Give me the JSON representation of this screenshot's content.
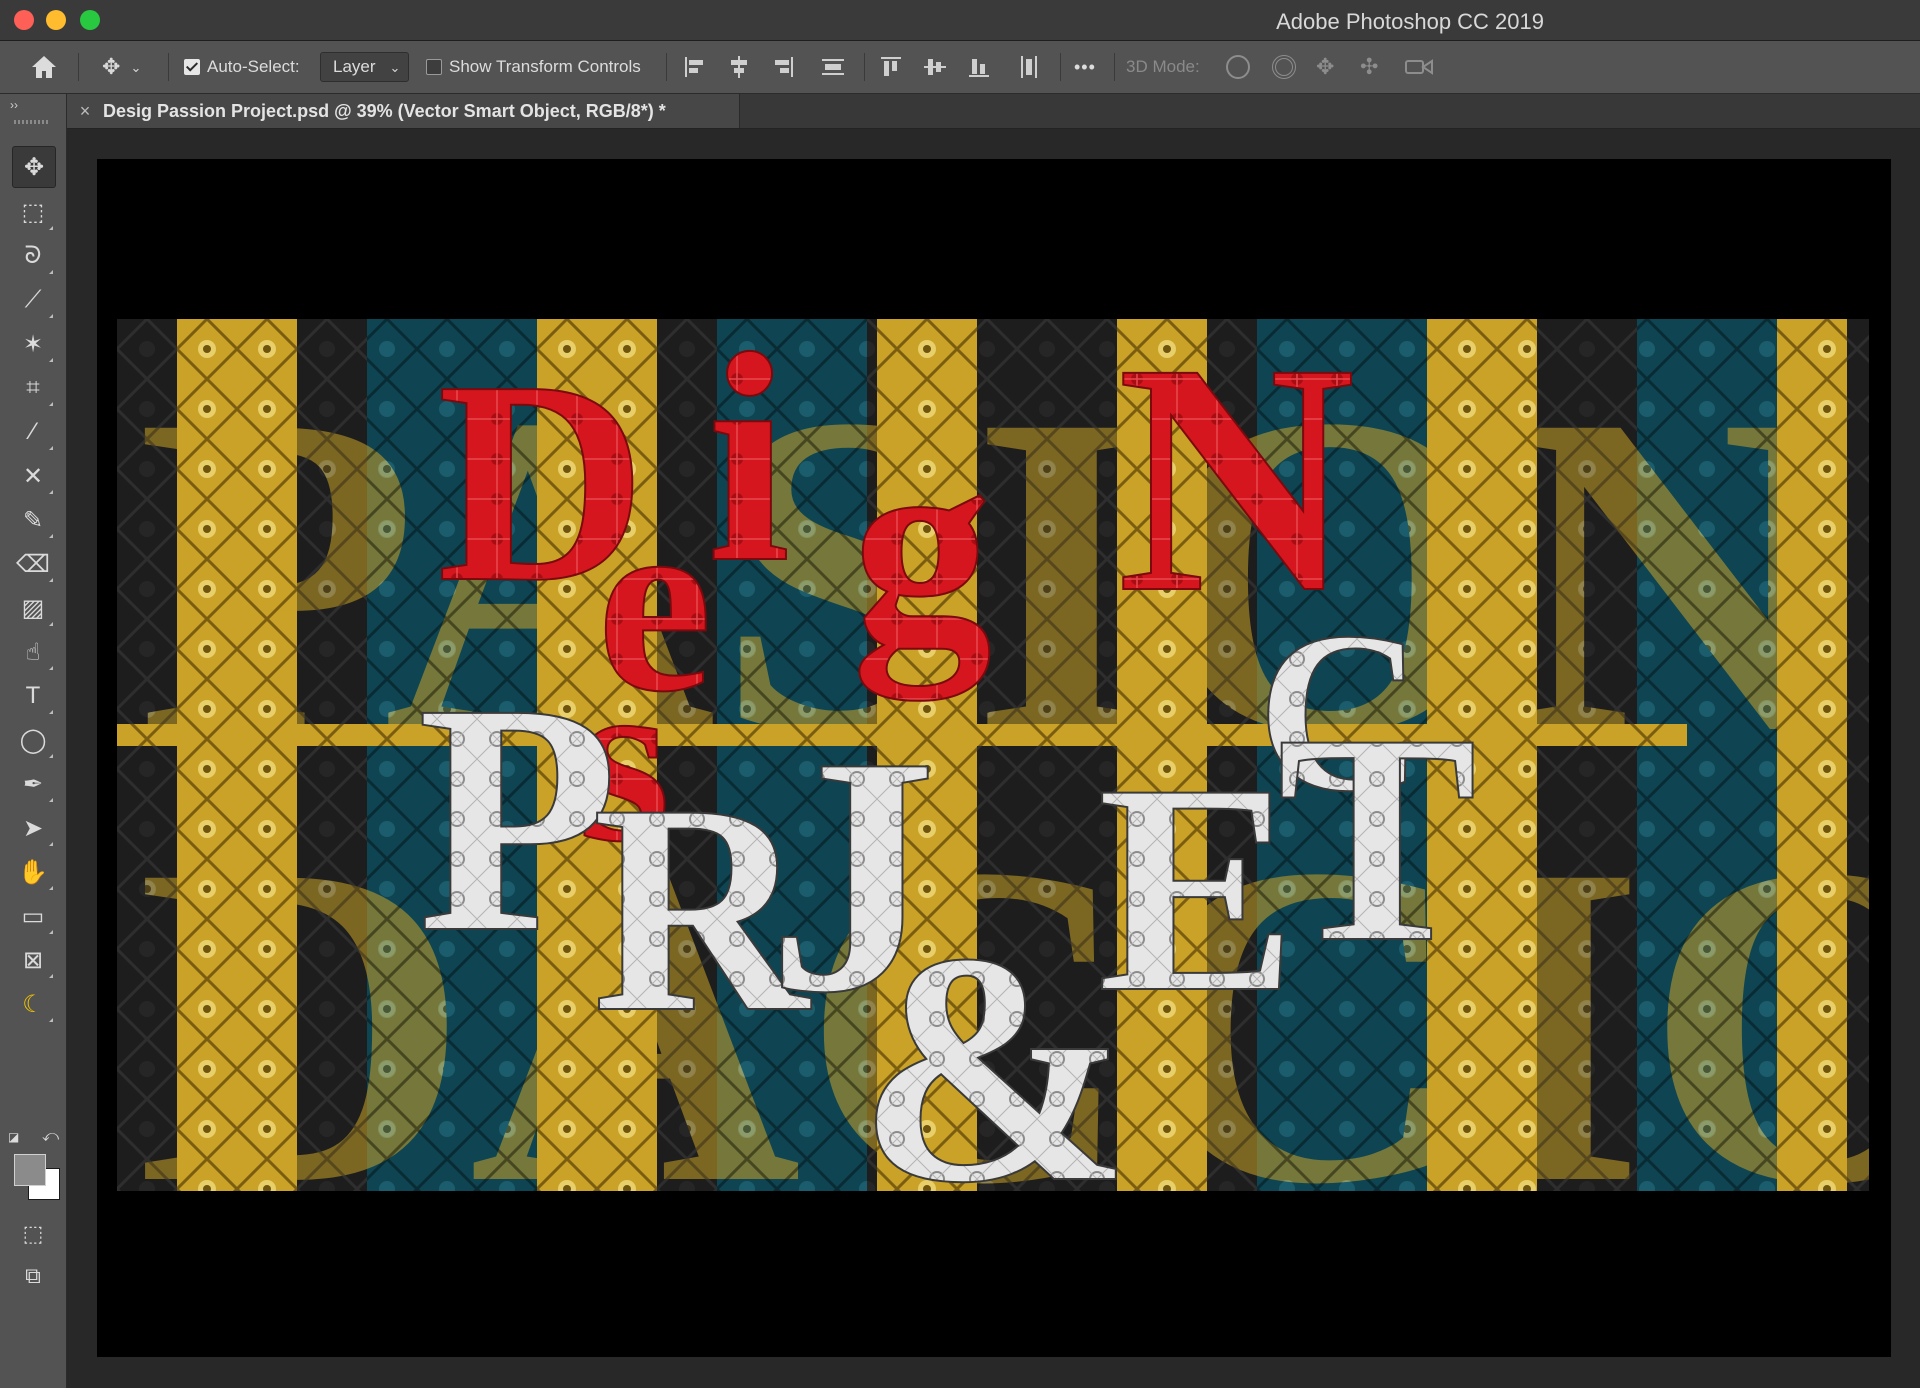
{
  "window": {
    "title": "Adobe Photoshop CC 2019"
  },
  "options_bar": {
    "auto_select_label": "Auto-Select:",
    "auto_select_checked": true,
    "auto_select_target": "Layer",
    "show_transform_label": "Show Transform Controls",
    "show_transform_checked": false,
    "more_label": "•••",
    "three_d_mode_label": "3D Mode:"
  },
  "panel_strip": {
    "collapse_label": "››"
  },
  "document": {
    "tab_title": "Desig Passion Project.psd @ 39% (Vector Smart Object, RGB/8*) *",
    "close_label": "×"
  },
  "tools": [
    {
      "name": "move-tool",
      "glyph": "✥",
      "active": true
    },
    {
      "name": "marquee-tool",
      "glyph": "⬚"
    },
    {
      "name": "lasso-tool",
      "glyph": "ᘐ"
    },
    {
      "name": "quick-selection-tool",
      "glyph": "⟋"
    },
    {
      "name": "magic-wand-tool",
      "glyph": "✶"
    },
    {
      "name": "crop-tool",
      "glyph": "⌗"
    },
    {
      "name": "eyedropper-tool",
      "glyph": "⁄"
    },
    {
      "name": "healing-tool",
      "glyph": "✕"
    },
    {
      "name": "brush-tool",
      "glyph": "✎"
    },
    {
      "name": "eraser-tool",
      "glyph": "⌫"
    },
    {
      "name": "gradient-tool",
      "glyph": "▨"
    },
    {
      "name": "smudge-tool",
      "glyph": "☝"
    },
    {
      "name": "type-tool",
      "glyph": "T"
    },
    {
      "name": "ellipse-tool",
      "glyph": "◯"
    },
    {
      "name": "pen-tool",
      "glyph": "✒"
    },
    {
      "name": "path-selection-tool",
      "glyph": "➤"
    },
    {
      "name": "hand-tool",
      "glyph": "✋"
    },
    {
      "name": "ruler-tool",
      "glyph": "▭"
    },
    {
      "name": "frame-tool",
      "glyph": "⊠"
    },
    {
      "name": "banana-tool",
      "glyph": "☾"
    }
  ],
  "colors": {
    "foreground": "#8b8b8b",
    "background": "#ffffff",
    "art_yellow": "#c9a227",
    "art_teal": "#0f4552",
    "art_red": "#d5161e",
    "art_dark": "#1d1d1d"
  }
}
